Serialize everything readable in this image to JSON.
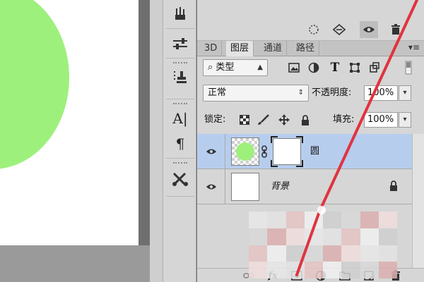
{
  "colors": {
    "accent_green": "#9ef07c",
    "selected_row": "#b7cdee",
    "annotation_red": "#e0333f"
  },
  "tabs": [
    {
      "label": "3D",
      "active": false
    },
    {
      "label": "图层",
      "active": true
    },
    {
      "label": "通道",
      "active": false
    },
    {
      "label": "路径",
      "active": false
    }
  ],
  "filter": {
    "kind_label": "类型",
    "filter_icons": [
      "image-filter-icon",
      "adjustment-filter-icon",
      "type-filter-icon",
      "shape-filter-icon",
      "smart-object-filter-icon",
      "filter-toggle-icon"
    ]
  },
  "blend": {
    "mode": "正常",
    "opacity_label": "不透明度:",
    "opacity_value": "100%"
  },
  "lock": {
    "label": "锁定:",
    "icons": [
      "lock-transparent-icon",
      "lock-brush-icon",
      "lock-move-icon",
      "lock-all-icon"
    ],
    "fill_label": "填充:",
    "fill_value": "100%"
  },
  "layers": [
    {
      "name": "圆",
      "selected": true,
      "visible": true,
      "has_mask": true
    },
    {
      "name": "背景",
      "selected": false,
      "visible": true,
      "locked": true
    }
  ],
  "tools": [
    "brushes-icon",
    "adjust-sliders-icon",
    "clone-stamp-icon",
    "character-icon",
    "paragraph-icon",
    "tool-presets-icon"
  ],
  "top_toolbar_icons": [
    "dashed-selection-icon",
    "diamond-arrows-icon",
    "eye-icon",
    "trash-icon"
  ],
  "bottom_icons": [
    "link-layers-icon",
    "fx-icon",
    "add-mask-icon",
    "adjustment-layer-icon",
    "new-group-icon",
    "new-layer-icon",
    "delete-layer-icon"
  ],
  "tool_labels": {
    "character": "A|",
    "paragraph": "¶"
  },
  "fx_label": "fx"
}
